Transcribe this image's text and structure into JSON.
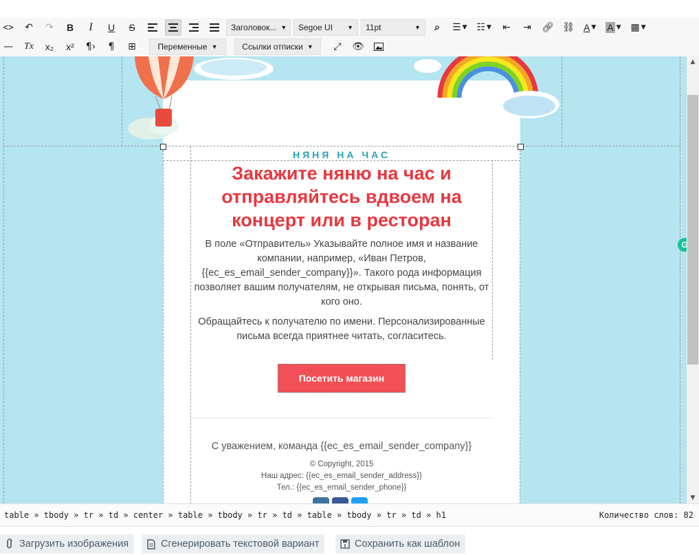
{
  "toolbar": {
    "row1": {
      "heading_select": "Заголовок...",
      "font_select": "Segoe UI",
      "size_select": "11pt"
    },
    "row2": {
      "variables_dropdown": "Переменные",
      "unsubscribe_dropdown": "Ссылки отписки"
    }
  },
  "email": {
    "eyebrow": "НЯНЯ НА ЧАС",
    "headline": "Закажите няню на час и отправляйтесь вдвоем на концерт или в ресторан",
    "paragraph1": "В поле «Отправитель» Указывайте полное имя и название компании, например, «Иван Петров, {{ec_es_email_sender_company}}». Такого рода информация позволяет вашим получателям, не открывая письма, понять, от кого оно.",
    "paragraph2": "Обращайтесь к получателю по имени. Персонализированные письма всегда приятнее читать, согласитесь.",
    "cta_button": "Посетить магазин",
    "regards": "С уважением, команда {{ec_es_email_sender_company}}",
    "copyright": "© Copyright, 2015",
    "address": "Наш адрес: {{ec_es_email_sender_address}}",
    "phone": "Тел.: {{ec_es_email_sender_phone}}"
  },
  "grammarly": "G",
  "statusbar": {
    "path": "table » tbody » tr » td » center » table » tbody » tr » td » table » tbody » tr » td » h1",
    "word_count": "Количество слов: 82"
  },
  "buttons": {
    "upload_images": "Загрузить изображения",
    "generate_text": "Сгенерировать текстовой вариант",
    "save_template": "Сохранить как шаблон"
  },
  "colors": {
    "editor_bg": "#b4e5f1",
    "headline": "#e8373f",
    "eyebrow": "#29a3b5",
    "cta": "#f05056"
  }
}
